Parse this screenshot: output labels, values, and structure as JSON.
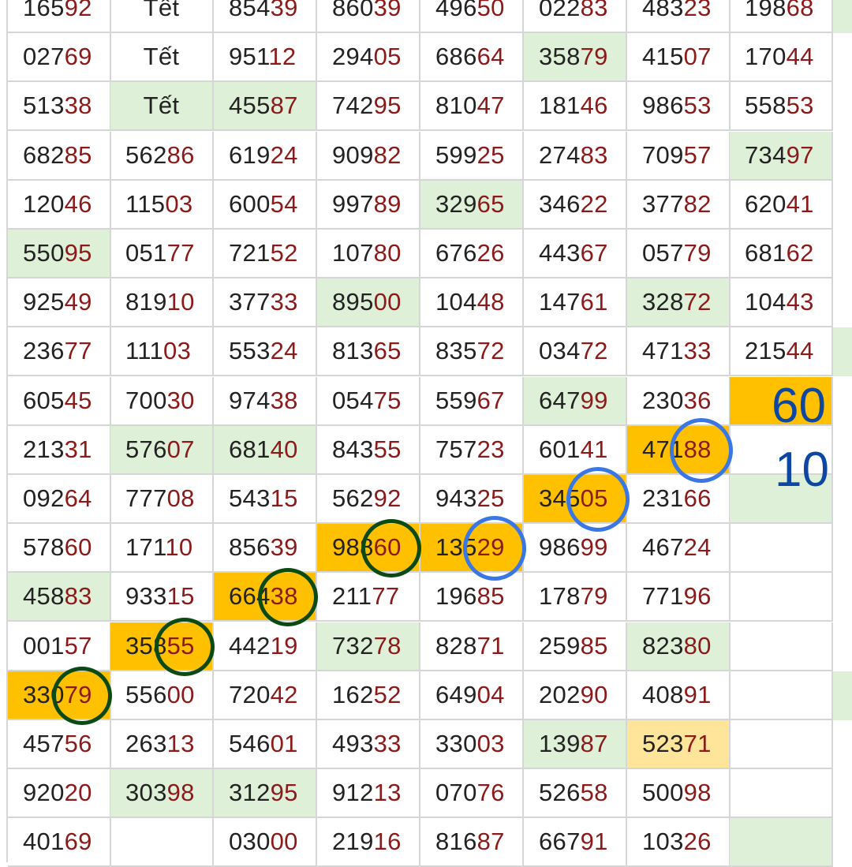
{
  "colors": {
    "green": "#dff0d8",
    "orange": "#ffc000",
    "yellow": "#ffe599",
    "digit_dark": "#222222",
    "digit_tail": "#8b1a1a",
    "note": "#0d47a1",
    "mark_green": "#0c4a14",
    "mark_blue": "#3a76e4"
  },
  "rows": [
    [
      [
        "16592",
        ""
      ],
      [
        "Tết",
        ""
      ],
      [
        "85439",
        ""
      ],
      [
        "86039",
        ""
      ],
      [
        "49650",
        ""
      ],
      [
        "02283",
        ""
      ],
      [
        "48323",
        ""
      ],
      [
        "19868",
        ""
      ]
    ],
    [
      [
        "02769",
        ""
      ],
      [
        "Tết",
        ""
      ],
      [
        "95112",
        ""
      ],
      [
        "29405",
        ""
      ],
      [
        "68664",
        ""
      ],
      [
        "35879",
        "g"
      ],
      [
        "41507",
        ""
      ],
      [
        "17044",
        ""
      ]
    ],
    [
      [
        "51338",
        ""
      ],
      [
        "Tết",
        "g"
      ],
      [
        "45587",
        "g"
      ],
      [
        "74295",
        ""
      ],
      [
        "81047",
        ""
      ],
      [
        "18146",
        ""
      ],
      [
        "98653",
        ""
      ],
      [
        "55853",
        ""
      ]
    ],
    [
      [
        "68285",
        ""
      ],
      [
        "56286",
        ""
      ],
      [
        "61924",
        ""
      ],
      [
        "90982",
        ""
      ],
      [
        "59925",
        ""
      ],
      [
        "27483",
        ""
      ],
      [
        "70957",
        ""
      ],
      [
        "73497",
        "g"
      ]
    ],
    [
      [
        "12046",
        ""
      ],
      [
        "11503",
        ""
      ],
      [
        "60054",
        ""
      ],
      [
        "99789",
        ""
      ],
      [
        "32965",
        "g"
      ],
      [
        "34622",
        ""
      ],
      [
        "37782",
        ""
      ],
      [
        "62041",
        ""
      ]
    ],
    [
      [
        "55095",
        "g"
      ],
      [
        "05177",
        ""
      ],
      [
        "72152",
        ""
      ],
      [
        "10780",
        ""
      ],
      [
        "67626",
        ""
      ],
      [
        "44367",
        ""
      ],
      [
        "05779",
        ""
      ],
      [
        "68162",
        ""
      ]
    ],
    [
      [
        "92549",
        ""
      ],
      [
        "81910",
        ""
      ],
      [
        "37733",
        ""
      ],
      [
        "89500",
        "g"
      ],
      [
        "10448",
        ""
      ],
      [
        "14761",
        ""
      ],
      [
        "32872",
        "g"
      ],
      [
        "10443",
        ""
      ]
    ],
    [
      [
        "23677",
        ""
      ],
      [
        "11103",
        ""
      ],
      [
        "55324",
        ""
      ],
      [
        "81365",
        ""
      ],
      [
        "83572",
        ""
      ],
      [
        "03472",
        ""
      ],
      [
        "47133",
        ""
      ],
      [
        "21544",
        ""
      ]
    ],
    [
      [
        "60545",
        ""
      ],
      [
        "70030",
        ""
      ],
      [
        "97438",
        ""
      ],
      [
        "05475",
        ""
      ],
      [
        "55967",
        ""
      ],
      [
        "64799",
        "g"
      ],
      [
        "23036",
        ""
      ],
      [
        "",
        "o"
      ]
    ],
    [
      [
        "21331",
        ""
      ],
      [
        "57607",
        "g"
      ],
      [
        "68140",
        "g"
      ],
      [
        "84355",
        ""
      ],
      [
        "75723",
        ""
      ],
      [
        "60141",
        ""
      ],
      [
        "47188",
        "o"
      ],
      [
        "",
        ""
      ]
    ],
    [
      [
        "09264",
        ""
      ],
      [
        "77708",
        ""
      ],
      [
        "54315",
        ""
      ],
      [
        "56292",
        ""
      ],
      [
        "94325",
        ""
      ],
      [
        "34505",
        "o"
      ],
      [
        "23166",
        ""
      ],
      [
        "",
        "g"
      ]
    ],
    [
      [
        "57860",
        ""
      ],
      [
        "17110",
        ""
      ],
      [
        "85639",
        ""
      ],
      [
        "98860",
        "o"
      ],
      [
        "13529",
        "o"
      ],
      [
        "98699",
        ""
      ],
      [
        "46724",
        ""
      ],
      [
        "",
        ""
      ]
    ],
    [
      [
        "45883",
        "g"
      ],
      [
        "93315",
        ""
      ],
      [
        "66438",
        "o"
      ],
      [
        "21177",
        ""
      ],
      [
        "19685",
        ""
      ],
      [
        "17879",
        ""
      ],
      [
        "77196",
        ""
      ],
      [
        "",
        ""
      ]
    ],
    [
      [
        "00157",
        ""
      ],
      [
        "35855",
        "o"
      ],
      [
        "44219",
        ""
      ],
      [
        "73278",
        "g"
      ],
      [
        "82871",
        ""
      ],
      [
        "25985",
        ""
      ],
      [
        "82380",
        "g"
      ],
      [
        "",
        ""
      ]
    ],
    [
      [
        "33079",
        "o"
      ],
      [
        "55600",
        ""
      ],
      [
        "72042",
        ""
      ],
      [
        "16252",
        ""
      ],
      [
        "64904",
        ""
      ],
      [
        "20290",
        ""
      ],
      [
        "40891",
        ""
      ],
      [
        "",
        ""
      ]
    ],
    [
      [
        "45756",
        ""
      ],
      [
        "26313",
        ""
      ],
      [
        "54601",
        ""
      ],
      [
        "49333",
        ""
      ],
      [
        "33003",
        ""
      ],
      [
        "13987",
        "g"
      ],
      [
        "52371",
        "y"
      ],
      [
        "",
        ""
      ]
    ],
    [
      [
        "92020",
        ""
      ],
      [
        "30398",
        "g"
      ],
      [
        "31295",
        "g"
      ],
      [
        "91213",
        ""
      ],
      [
        "07076",
        ""
      ],
      [
        "52658",
        ""
      ],
      [
        "50098",
        ""
      ],
      [
        "",
        ""
      ]
    ],
    [
      [
        "40169",
        ""
      ],
      [
        "",
        ""
      ],
      [
        "03000",
        ""
      ],
      [
        "21916",
        ""
      ],
      [
        "81687",
        ""
      ],
      [
        "66791",
        ""
      ],
      [
        "10326",
        ""
      ],
      [
        "",
        "g"
      ]
    ]
  ],
  "edge_green_rows": [
    0,
    7,
    14
  ],
  "notes": {
    "first": "60",
    "second": "10"
  },
  "marks": [
    {
      "name": "circle-mark-green-33079",
      "color": "green",
      "row": 14,
      "col": 0
    },
    {
      "name": "circle-mark-green-35855",
      "color": "green",
      "row": 13,
      "col": 1
    },
    {
      "name": "circle-mark-green-66438",
      "color": "green",
      "row": 12,
      "col": 2
    },
    {
      "name": "circle-mark-green-98860",
      "color": "green",
      "row": 11,
      "col": 3
    },
    {
      "name": "circle-mark-blue-13529",
      "color": "blue",
      "row": 11,
      "col": 4
    },
    {
      "name": "circle-mark-blue-34505",
      "color": "blue",
      "row": 10,
      "col": 5
    },
    {
      "name": "circle-mark-blue-47188",
      "color": "blue",
      "row": 9,
      "col": 6
    }
  ]
}
